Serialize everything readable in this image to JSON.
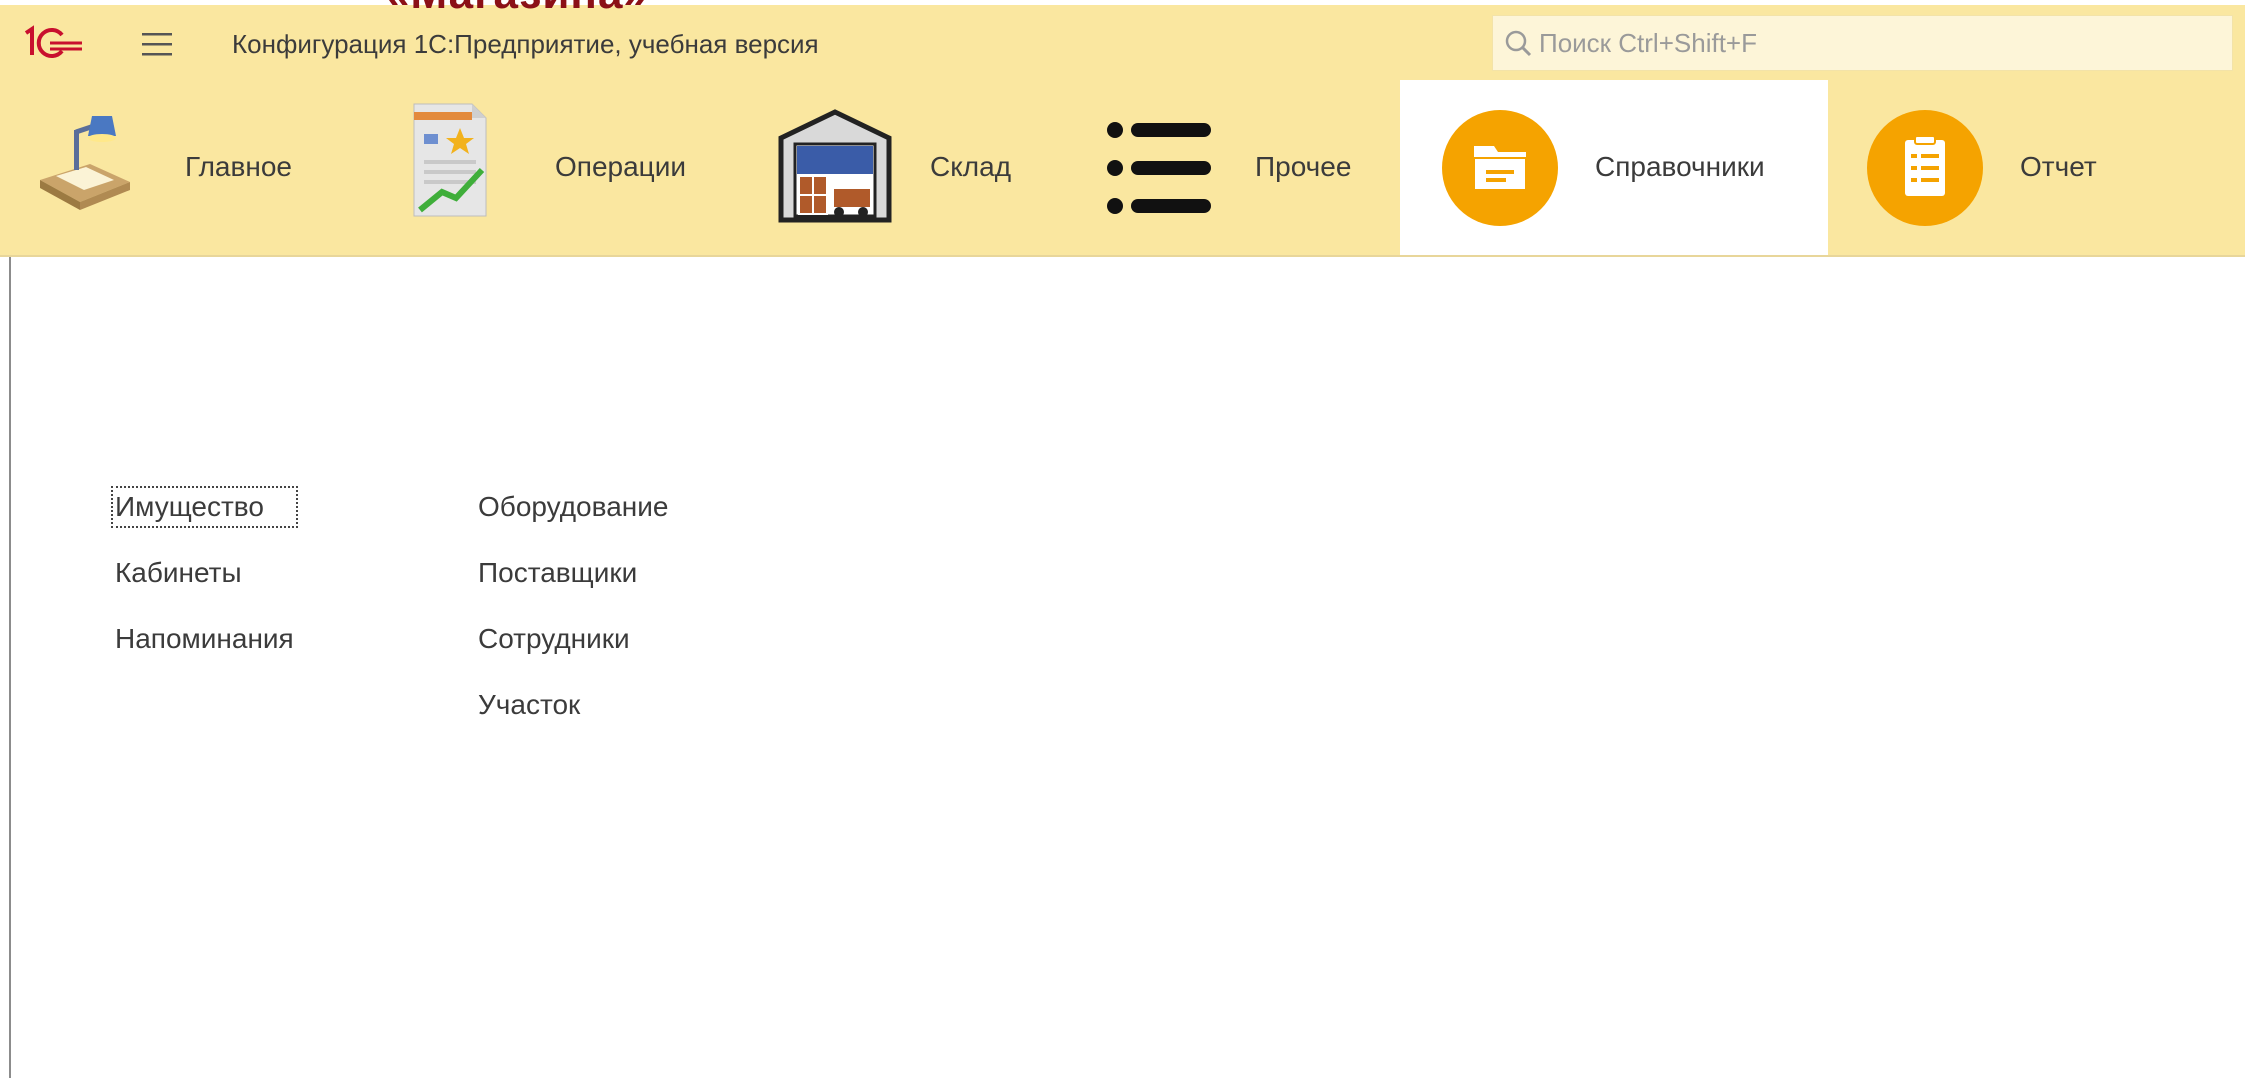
{
  "window": {
    "clipped_heading": "«Магазина»",
    "title": "Конфигурация 1С:Предприятие, учебная версия"
  },
  "search": {
    "placeholder": "Поиск Ctrl+Shift+F"
  },
  "sections": [
    {
      "label": "Главное",
      "icon": "desk-lamp-icon"
    },
    {
      "label": "Операции",
      "icon": "document-chart-icon"
    },
    {
      "label": "Склад",
      "icon": "warehouse-icon"
    },
    {
      "label": "Прочее",
      "icon": "list-icon"
    },
    {
      "label": "Справочники",
      "icon": "folder-icon",
      "active": true
    },
    {
      "label": "Отчет",
      "icon": "clipboard-icon"
    }
  ],
  "content": {
    "column1": [
      "Имущество",
      "Кабинеты",
      "Напоминания"
    ],
    "column2": [
      "Оборудование",
      "Поставщики",
      "Сотрудники",
      "Участок"
    ]
  },
  "colors": {
    "panel_bg": "#fae7a0",
    "accent_orange": "#f5a300",
    "heading_red": "#8b1017"
  }
}
